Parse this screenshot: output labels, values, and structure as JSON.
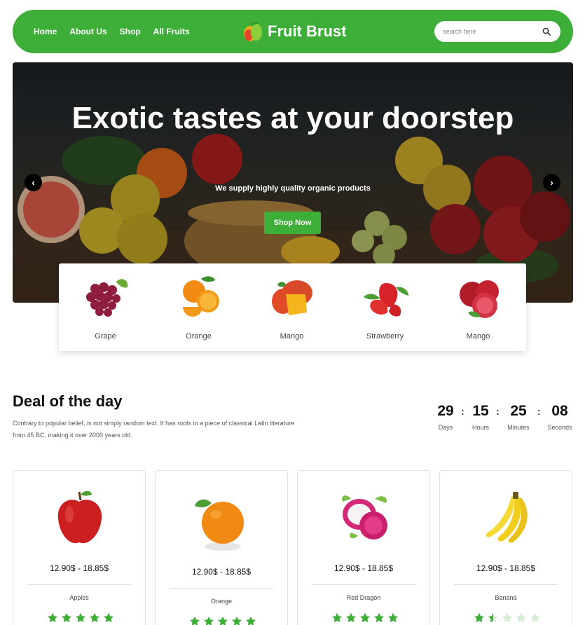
{
  "nav": {
    "links": [
      "Home",
      "About Us",
      "Shop",
      "All Fruits"
    ],
    "brand": "Fruit Brust",
    "search_placeholder": "search here"
  },
  "hero": {
    "title": "Exotic tastes at your doorstep",
    "subtitle": "We supply highly quality organic products",
    "cta": "Shop Now",
    "prev": "‹",
    "next": "›"
  },
  "categories": [
    "Grape",
    "Orange",
    "Mango",
    "Strawberry",
    "Mango"
  ],
  "deal": {
    "title": "Deal of the day",
    "description": "Contrary to popular belief, is not simply random text. It has roots in a piece of classical Latin literature from 45 BC, making it over 2000 years old.",
    "countdown": [
      {
        "value": "29",
        "label": "Days"
      },
      {
        "value": "15",
        "label": "Hours"
      },
      {
        "value": "25",
        "label": "Minutes"
      },
      {
        "value": "08",
        "label": "Seconds"
      }
    ],
    "separator": ":"
  },
  "products": [
    {
      "name": "Apples",
      "price": "12.90$ - 18.85$",
      "rating": 5
    },
    {
      "name": "Orange",
      "price": "12.90$ - 18.85$",
      "rating": 5
    },
    {
      "name": "Red Dragon",
      "price": "12.90$ - 18.85$",
      "rating": 5
    },
    {
      "name": "Banana",
      "price": "12.90$ - 18.85$",
      "rating": 1.5
    }
  ],
  "colors": {
    "brand_green": "#3dae38",
    "star_empty": "#d6ecd5"
  }
}
